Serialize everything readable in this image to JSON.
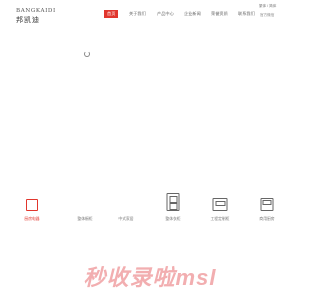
{
  "header": {
    "logo": {
      "en": "BANGKAIDI",
      "cn": "邦凯迪"
    },
    "nav": [
      {
        "label": "首页",
        "active": true
      },
      {
        "label": "关于我们"
      },
      {
        "label": "产品中心"
      },
      {
        "label": "企业新闻"
      },
      {
        "label": "荣誉资质"
      },
      {
        "label": "联系我们"
      }
    ],
    "lang": "繁体 / 简体",
    "wechat": "官方微信"
  },
  "features": [
    {
      "label": "厨房电器",
      "icon": "document-icon",
      "active": true
    },
    {
      "label": "整体橱柜"
    },
    {
      "label": "中式家居"
    },
    {
      "label": "整体衣柜",
      "icon": "cabinet-icon"
    },
    {
      "label": "工程定制柜",
      "icon": "machine-icon"
    },
    {
      "label": "商用厨房",
      "icon": "stove-icon"
    }
  ],
  "watermark": "秒收录啦msl",
  "colors": {
    "accent": "#e1362d",
    "watermark": "#f2aeb0"
  }
}
